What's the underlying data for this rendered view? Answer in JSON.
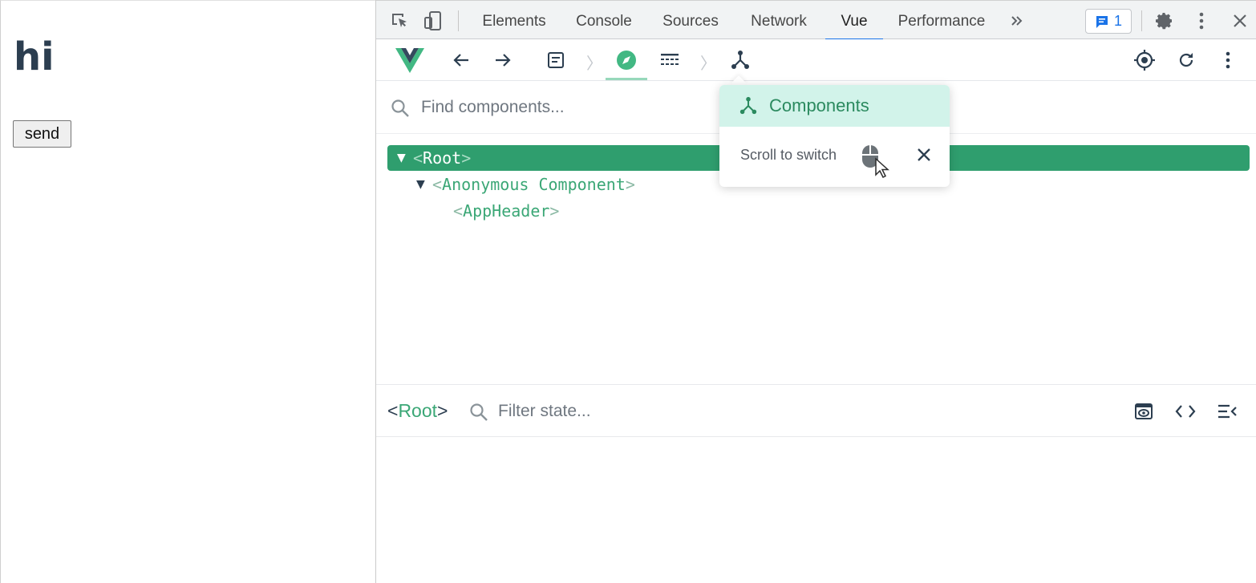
{
  "page": {
    "heading": "hi",
    "send_button": "send"
  },
  "devtools": {
    "tabs": [
      {
        "label": "Elements",
        "active": false
      },
      {
        "label": "Console",
        "active": false
      },
      {
        "label": "Sources",
        "active": false
      },
      {
        "label": "Network",
        "active": false
      },
      {
        "label": "Vue",
        "active": true
      },
      {
        "label": "Performance",
        "active": false
      }
    ],
    "more_tabs_icon": "double-chevron-right-icon",
    "issues_count": "1",
    "accent": "#1a73e8"
  },
  "vue": {
    "brand_color": "#42b883",
    "toolbar_icons": [
      "vue-logo-icon",
      "back-arrow-icon",
      "forward-arrow-icon",
      "app-selector-icon",
      "inspector-compass-icon",
      "timeline-icon",
      "components-icon",
      "select-target-icon",
      "refresh-icon",
      "more-vertical-icon"
    ],
    "search": {
      "placeholder": "Find components..."
    },
    "tree": {
      "root": {
        "name": "Root",
        "selected": true
      },
      "anonymous": {
        "name": "Anonymous Component"
      },
      "app_header": {
        "name": "AppHeader"
      }
    },
    "state": {
      "selected_name": "Root",
      "filter_placeholder": "Filter state..."
    },
    "popup": {
      "item_label": "Components",
      "hint": "Scroll to switch"
    }
  }
}
